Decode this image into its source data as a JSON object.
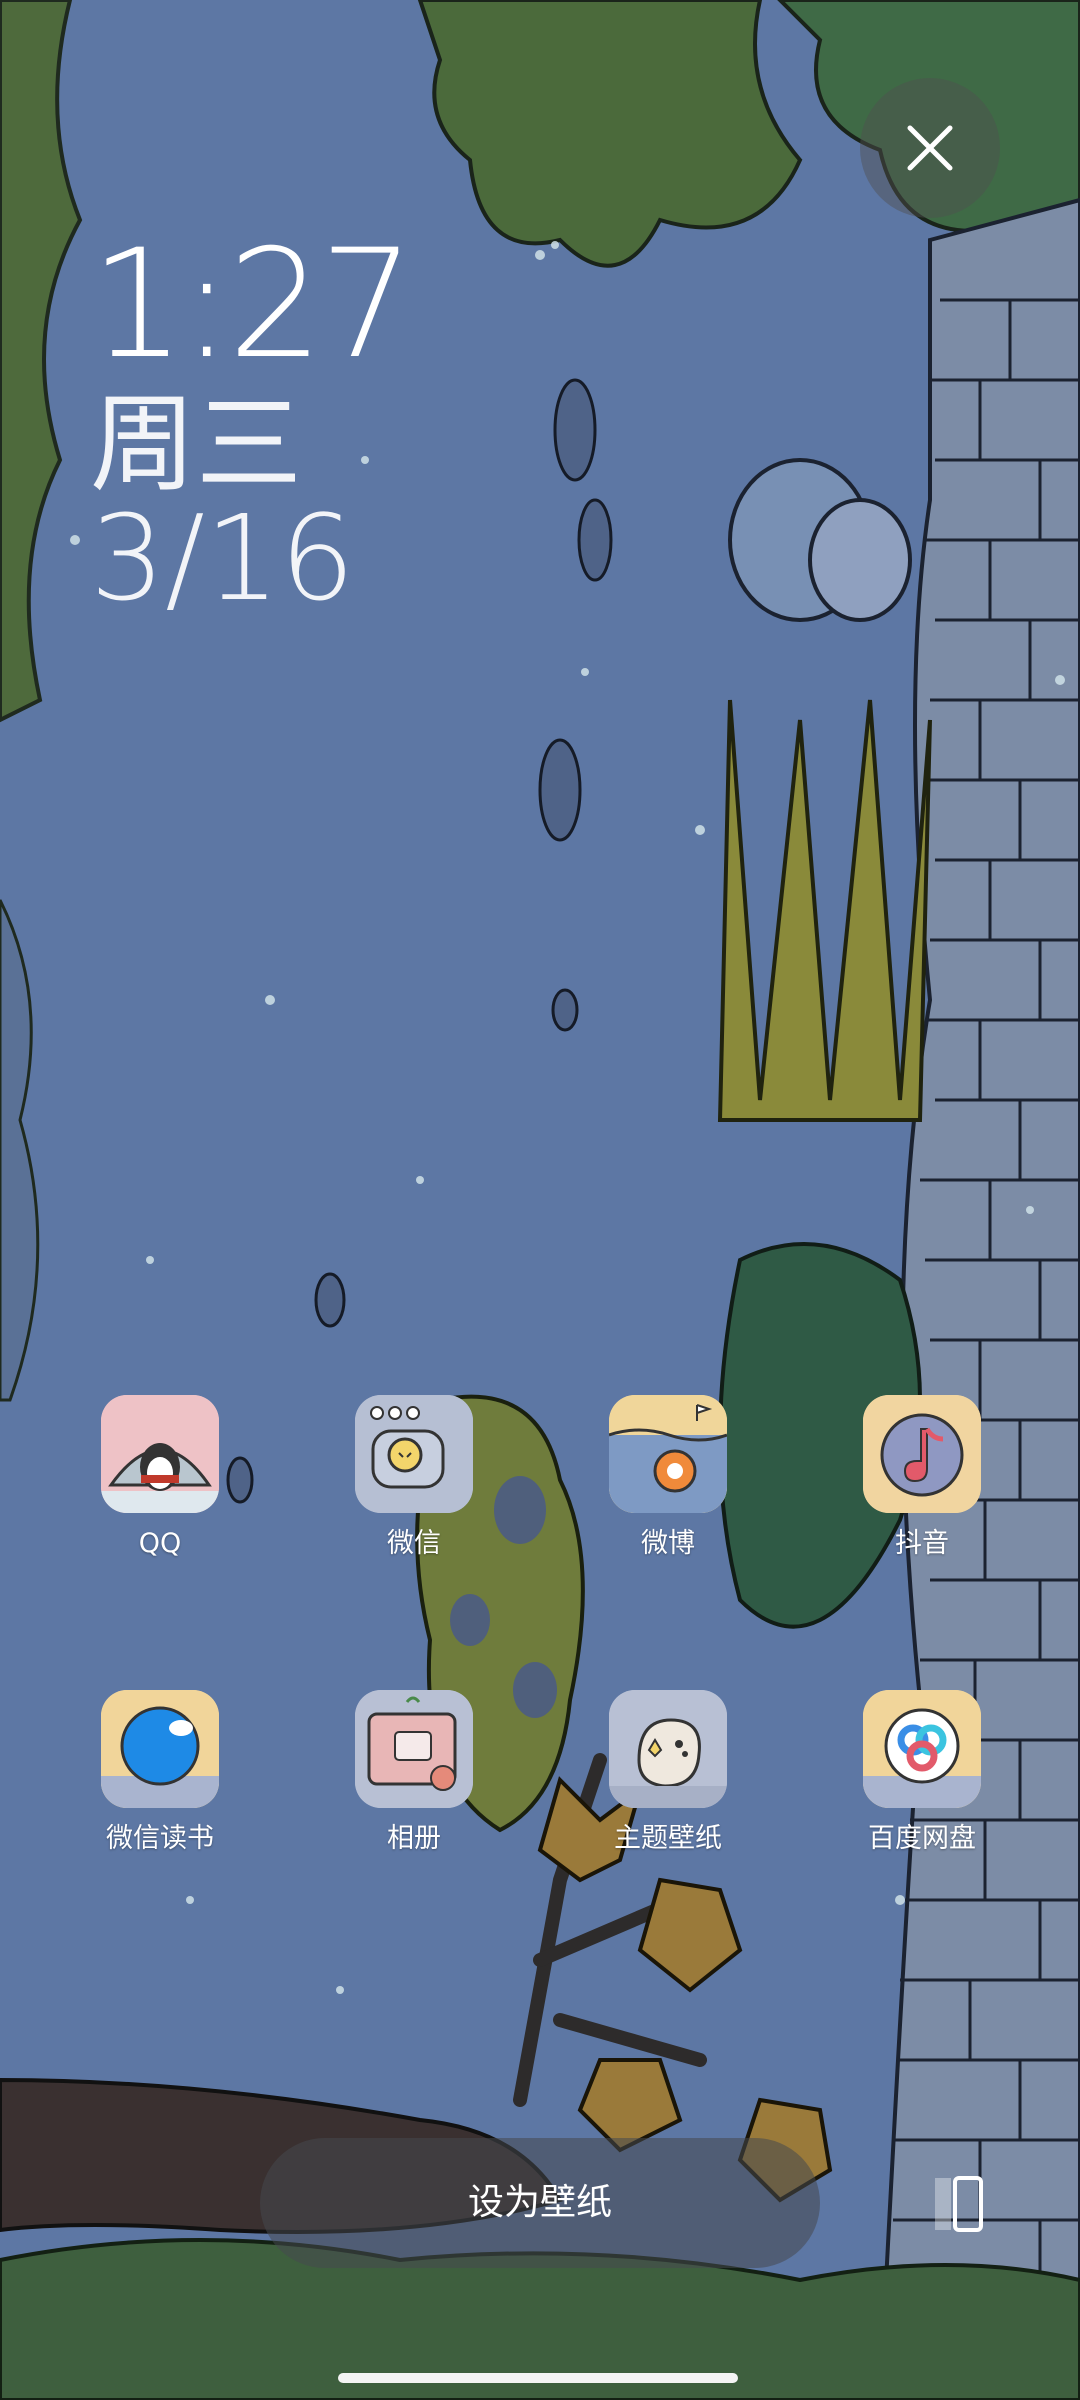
{
  "clock": {
    "time": "1:27",
    "weekday": "周三",
    "date": "3/16"
  },
  "apps": [
    {
      "label": "QQ",
      "icon": "qq-penguin-icon"
    },
    {
      "label": "微信",
      "icon": "wechat-chat-icon"
    },
    {
      "label": "微博",
      "icon": "weibo-icon"
    },
    {
      "label": "抖音",
      "icon": "douyin-music-icon"
    },
    {
      "label": "微信读书",
      "icon": "wechat-read-icon"
    },
    {
      "label": "相册",
      "icon": "gallery-icon"
    },
    {
      "label": "主题壁纸",
      "icon": "theme-wallpaper-icon"
    },
    {
      "label": "百度网盘",
      "icon": "baidu-netdisk-icon"
    }
  ],
  "actions": {
    "set_wallpaper": "设为壁纸"
  },
  "colors": {
    "sky": "#5d77a4",
    "tree_green": "#4f6b3e",
    "grass_yellow": "#8f8a3a",
    "dark_green": "#2f5a45"
  }
}
